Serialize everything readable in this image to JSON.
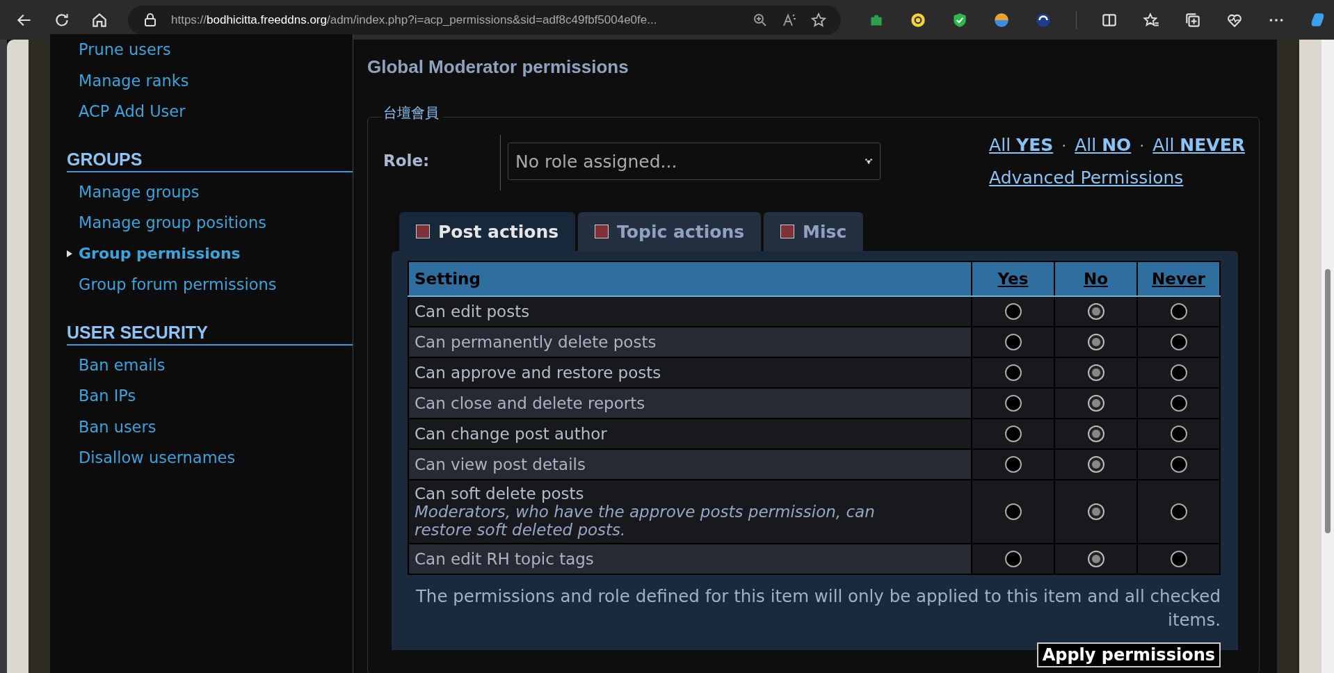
{
  "browser": {
    "url": "https://**bodhicitta.freeddns.org**/adm/index.php?i=acp_permissions&sid=adf8c49fbf5004e0fe..."
  },
  "sidebar": {
    "sections": [
      {
        "items": [
          {
            "label": "Prune users",
            "selected": false
          },
          {
            "label": "Manage ranks",
            "selected": false
          },
          {
            "label": "ACP Add User",
            "selected": false
          }
        ]
      },
      {
        "heading": "GROUPS",
        "items": [
          {
            "label": "Manage groups",
            "selected": false
          },
          {
            "label": "Manage group positions",
            "selected": false
          },
          {
            "label": "Group permissions",
            "selected": true
          },
          {
            "label": "Group forum permissions",
            "selected": false
          }
        ]
      },
      {
        "heading": "USER SECURITY",
        "items": [
          {
            "label": "Ban emails",
            "selected": false
          },
          {
            "label": "Ban IPs",
            "selected": false
          },
          {
            "label": "Ban users",
            "selected": false
          },
          {
            "label": "Disallow usernames",
            "selected": false
          }
        ]
      }
    ]
  },
  "page": {
    "title": "Global Moderator permissions",
    "group": "台壇會員",
    "role_label": "Role:",
    "role_placeholder": "No role assigned...",
    "all_links": [
      {
        "prefix": "All",
        "word": "YES"
      },
      {
        "prefix": "All",
        "word": "NO"
      },
      {
        "prefix": "All",
        "word": "NEVER"
      }
    ],
    "separator": "·",
    "advanced_link": "Advanced Permissions",
    "tabs": [
      {
        "label": "Post actions",
        "selected": true
      },
      {
        "label": "Topic actions",
        "selected": false
      },
      {
        "label": "Misc",
        "selected": false
      }
    ],
    "columns": [
      "Setting",
      "Yes",
      "No",
      "Never"
    ],
    "rows": [
      {
        "label": "Can edit posts",
        "radios": [
          {
            "selected": false
          },
          {
            "selected": true
          },
          {
            "selected": false
          }
        ]
      },
      {
        "label": "Can permanently delete posts",
        "radios": [
          {
            "selected": false
          },
          {
            "selected": true
          },
          {
            "selected": false
          }
        ]
      },
      {
        "label": "Can approve and restore posts",
        "radios": [
          {
            "selected": false
          },
          {
            "selected": true
          },
          {
            "selected": false
          }
        ]
      },
      {
        "label": "Can close and delete reports",
        "radios": [
          {
            "selected": false
          },
          {
            "selected": true
          },
          {
            "selected": false
          }
        ]
      },
      {
        "label": "Can change post author",
        "radios": [
          {
            "selected": false
          },
          {
            "selected": true
          },
          {
            "selected": false
          }
        ]
      },
      {
        "label": "Can view post details",
        "radios": [
          {
            "selected": false
          },
          {
            "selected": true
          },
          {
            "selected": false
          }
        ]
      },
      {
        "label": "Can soft delete posts",
        "note": "Moderators, who have the approve posts permission, can restore soft deleted posts.",
        "radios": [
          {
            "selected": false
          },
          {
            "selected": true
          },
          {
            "selected": false
          }
        ]
      },
      {
        "label": "Can edit RH topic tags",
        "radios": [
          {
            "selected": false
          },
          {
            "selected": true
          },
          {
            "selected": false
          }
        ]
      }
    ],
    "footer_note": "The permissions and role defined for this item will only be applied to this item and all checked items.",
    "apply_button": "Apply permissions"
  }
}
